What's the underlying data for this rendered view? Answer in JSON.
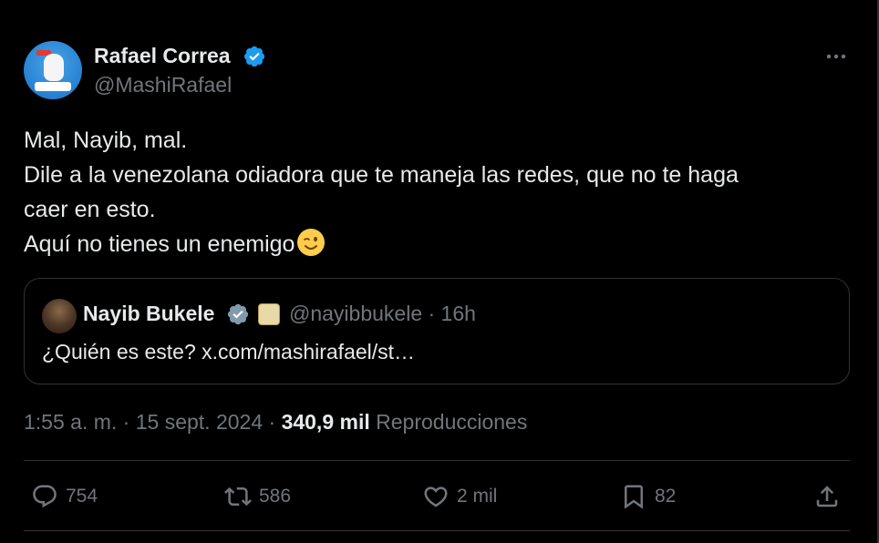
{
  "tweet": {
    "author": {
      "name": "Rafael Correa",
      "handle": "@MashiRafael",
      "avatar_icon": "profile-avatar",
      "verified_color": "#1d9bf0"
    },
    "text_lines": [
      "Mal, Nayib, mal.",
      "Dile a la venezolana odiadora que te maneja las redes, que no te haga",
      "caer en esto.",
      "Aquí no tienes un enemigo"
    ],
    "emoji": "winking-face-emoji",
    "quoted": {
      "name": "Nayib Bukele",
      "handle_time": "@nayibbukele · 16h",
      "text": "¿Quién es este? x.com/mashirafael/st…",
      "verified_color": "#829aab"
    },
    "meta": {
      "time_date": "1:55 a. m. · 15 sept. 2024 ·",
      "views": "340,9 mil",
      "views_label": "Reproducciones"
    },
    "actions": {
      "replies": "754",
      "reposts": "586",
      "likes": "2 mil",
      "bookmarks": "82"
    }
  },
  "colors": {
    "background": "#000000",
    "text": "#e7e9ea",
    "secondary": "#71767b",
    "border": "#2f3336"
  }
}
